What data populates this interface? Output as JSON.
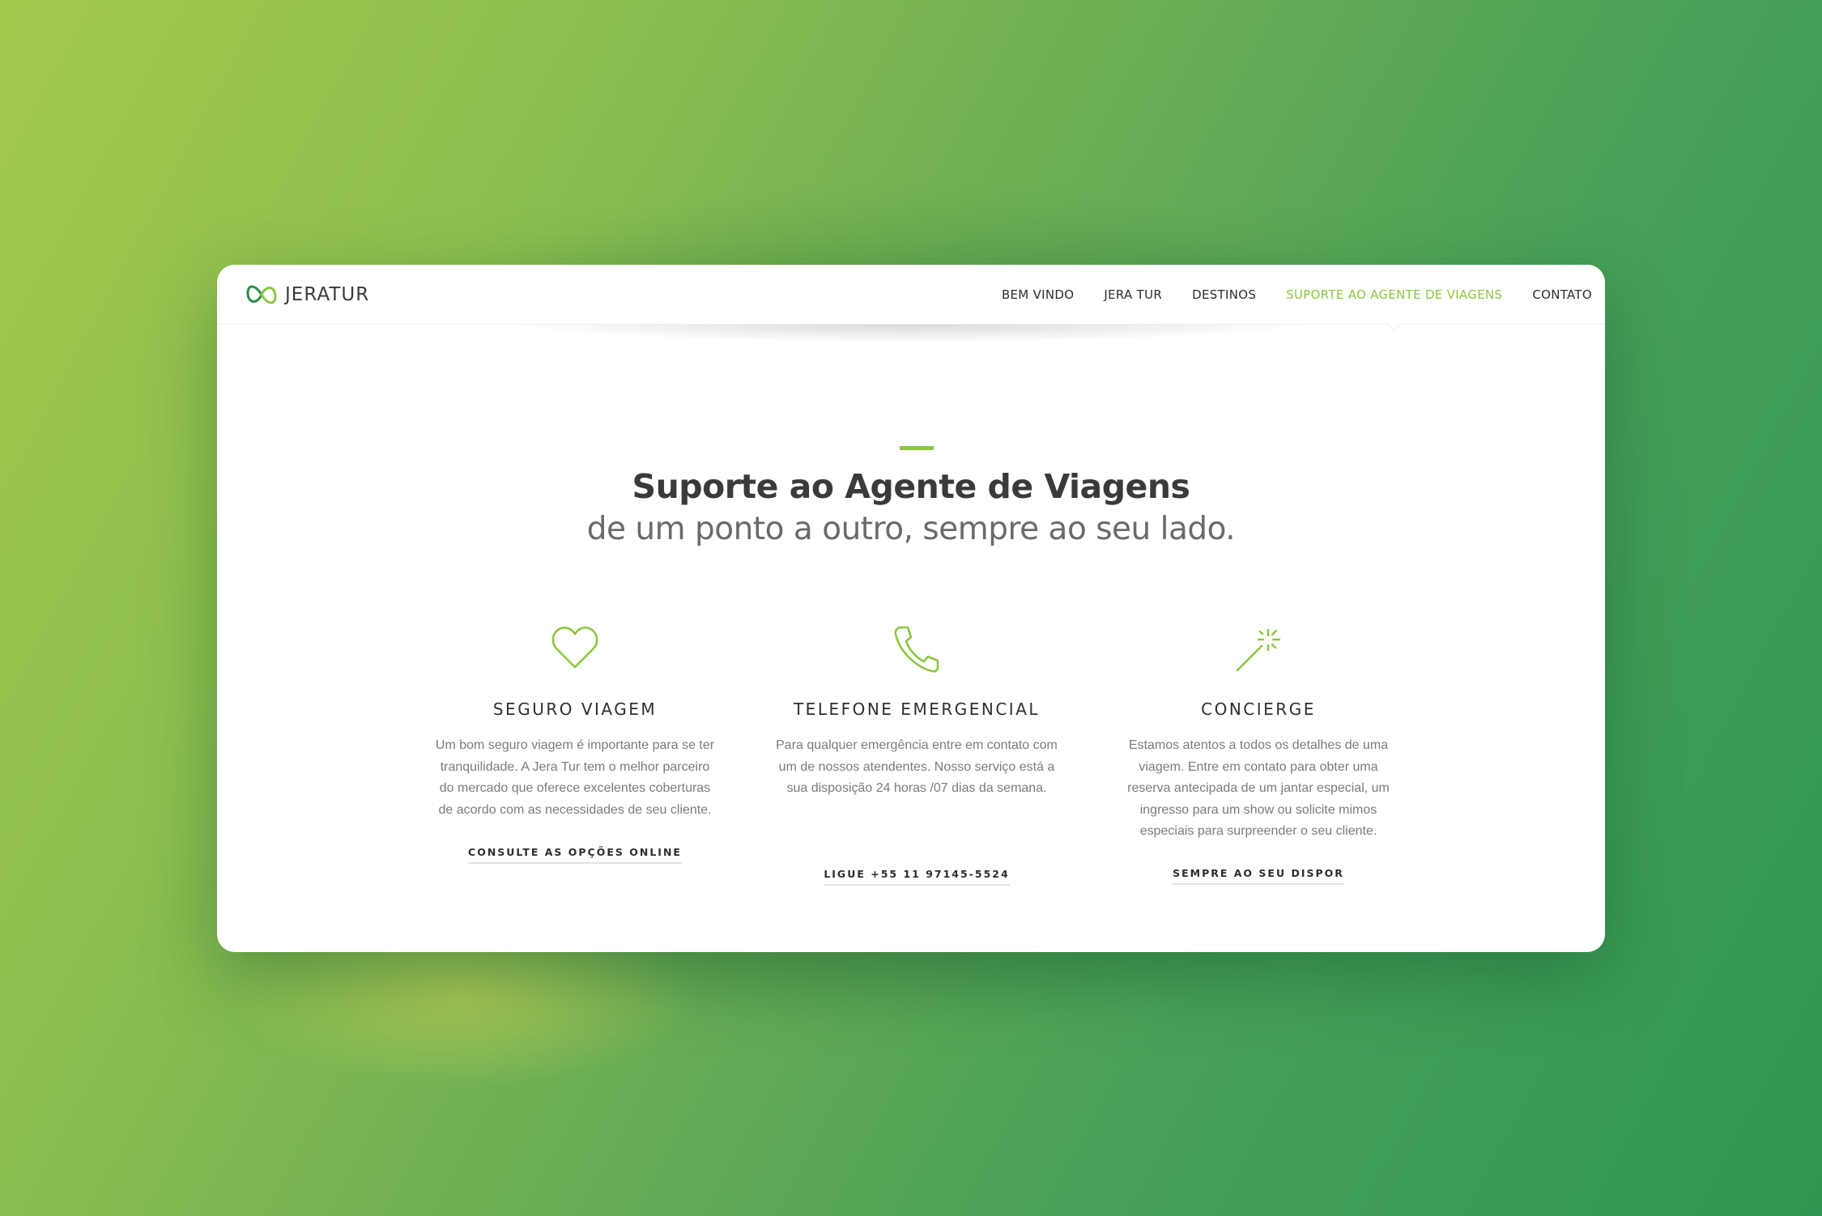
{
  "brand": {
    "name": "JERATUR",
    "accent_color": "#8cc640"
  },
  "nav": {
    "items": [
      {
        "label": "BEM VINDO",
        "active": false
      },
      {
        "label": "JERA TUR",
        "active": false
      },
      {
        "label": "DESTINOS",
        "active": false
      },
      {
        "label": "SUPORTE AO AGENTE DE VIAGENS",
        "active": true
      },
      {
        "label": "CONTATO",
        "active": false
      }
    ]
  },
  "hero": {
    "title": "Suporte ao Agente de Viagens",
    "subtitle": "de um ponto a outro, sempre ao seu lado."
  },
  "features": [
    {
      "icon": "heart-icon",
      "title": "SEGURO VIAGEM",
      "text": "Um bom seguro viagem é importante para se ter tranquilidade. A Jera Tur tem o melhor parceiro do mercado que oferece excelentes coberturas de acordo com as necessidades de seu cliente.",
      "link": "CONSULTE AS OPÇÕES ONLINE"
    },
    {
      "icon": "phone-icon",
      "title": "TELEFONE EMERGENCIAL",
      "text": "Para qualquer emergência entre em contato com um de nossos atendentes. Nosso serviço está a sua disposição 24 horas /07 dias da semana.",
      "link": "LIGUE +55 11 97145-5524"
    },
    {
      "icon": "magic-wand-icon",
      "title": "CONCIERGE",
      "text": "Estamos atentos a todos os detalhes de uma viagem. Entre em contato para obter uma reserva antecipada de um jantar especial, um ingresso para um show ou solicite mimos especiais para surpreender o seu cliente.",
      "link": "SEMPRE AO SEU DISPOR"
    }
  ]
}
